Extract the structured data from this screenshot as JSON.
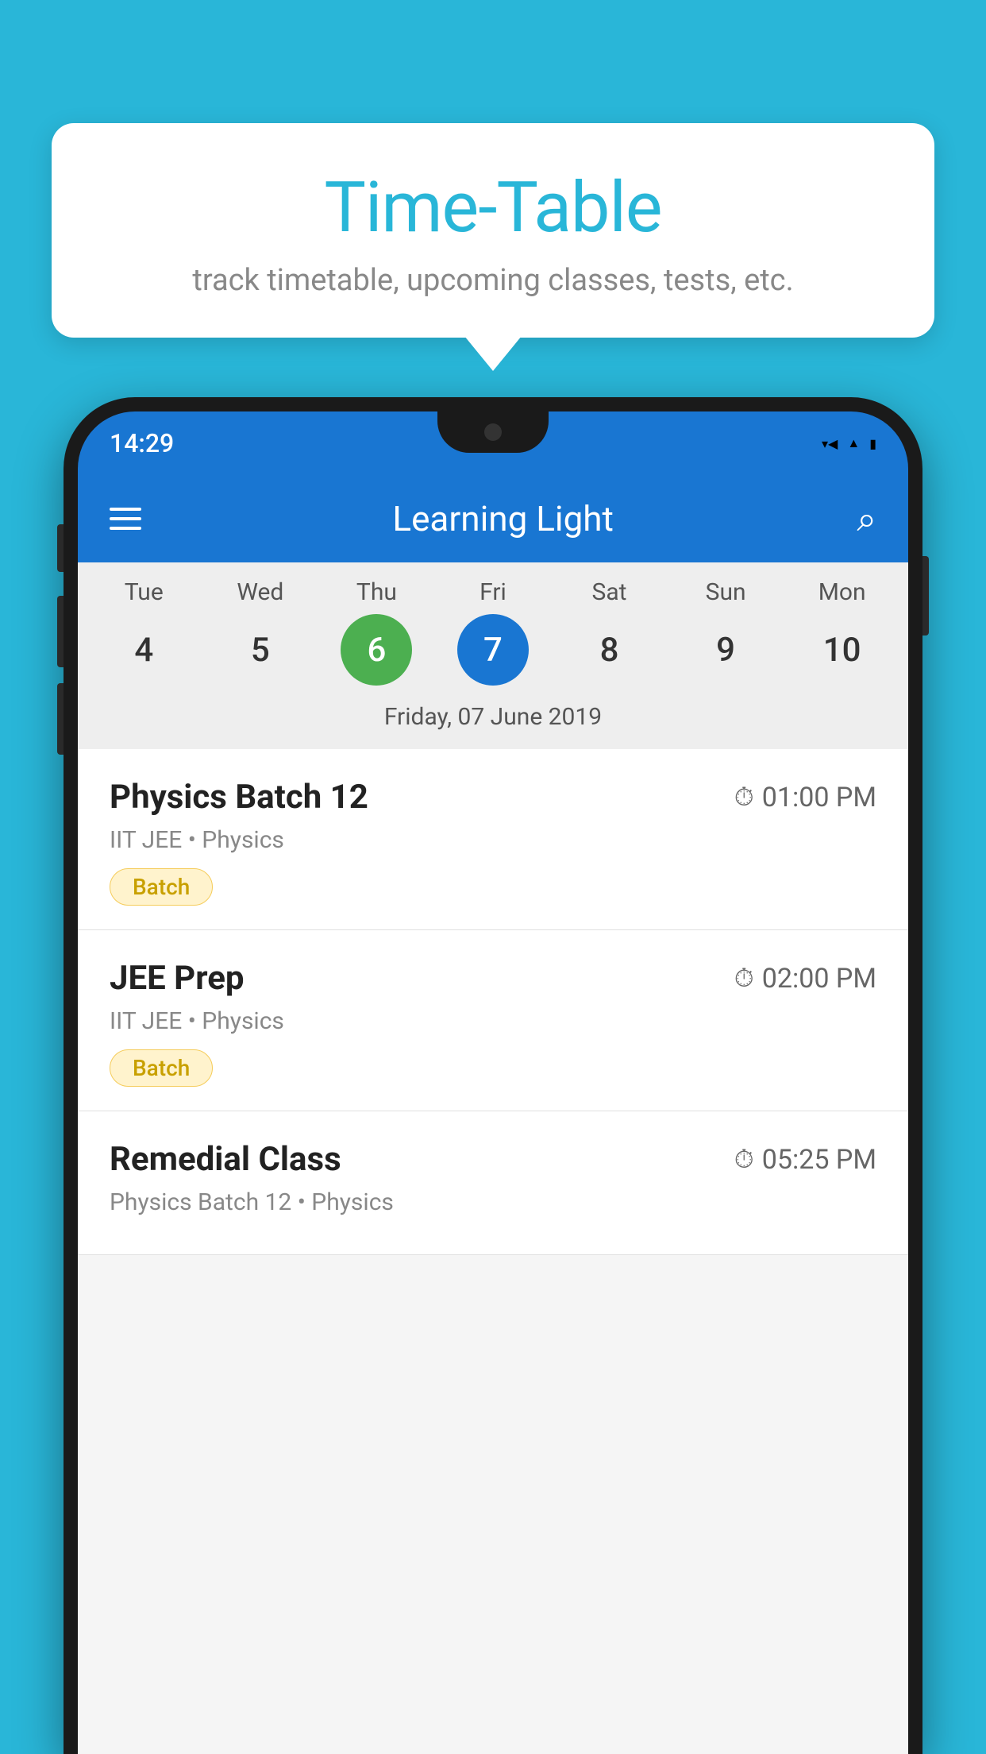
{
  "background_color": "#29B6D8",
  "tooltip": {
    "title": "Time-Table",
    "subtitle": "track timetable, upcoming classes, tests, etc."
  },
  "phone": {
    "status_time": "14:29",
    "app_name": "Learning Light",
    "calendar": {
      "days": [
        {
          "label": "Tue",
          "num": "4"
        },
        {
          "label": "Wed",
          "num": "5"
        },
        {
          "label": "Thu",
          "num": "6",
          "state": "today"
        },
        {
          "label": "Fri",
          "num": "7",
          "state": "selected"
        },
        {
          "label": "Sat",
          "num": "8"
        },
        {
          "label": "Sun",
          "num": "9"
        },
        {
          "label": "Mon",
          "num": "10"
        }
      ],
      "selected_date_label": "Friday, 07 June 2019"
    },
    "schedule": [
      {
        "title": "Physics Batch 12",
        "time": "01:00 PM",
        "meta": "IIT JEE • Physics",
        "badge": "Batch"
      },
      {
        "title": "JEE Prep",
        "time": "02:00 PM",
        "meta": "IIT JEE • Physics",
        "badge": "Batch"
      },
      {
        "title": "Remedial Class",
        "time": "05:25 PM",
        "meta": "Physics Batch 12 • Physics",
        "badge": null
      }
    ]
  }
}
